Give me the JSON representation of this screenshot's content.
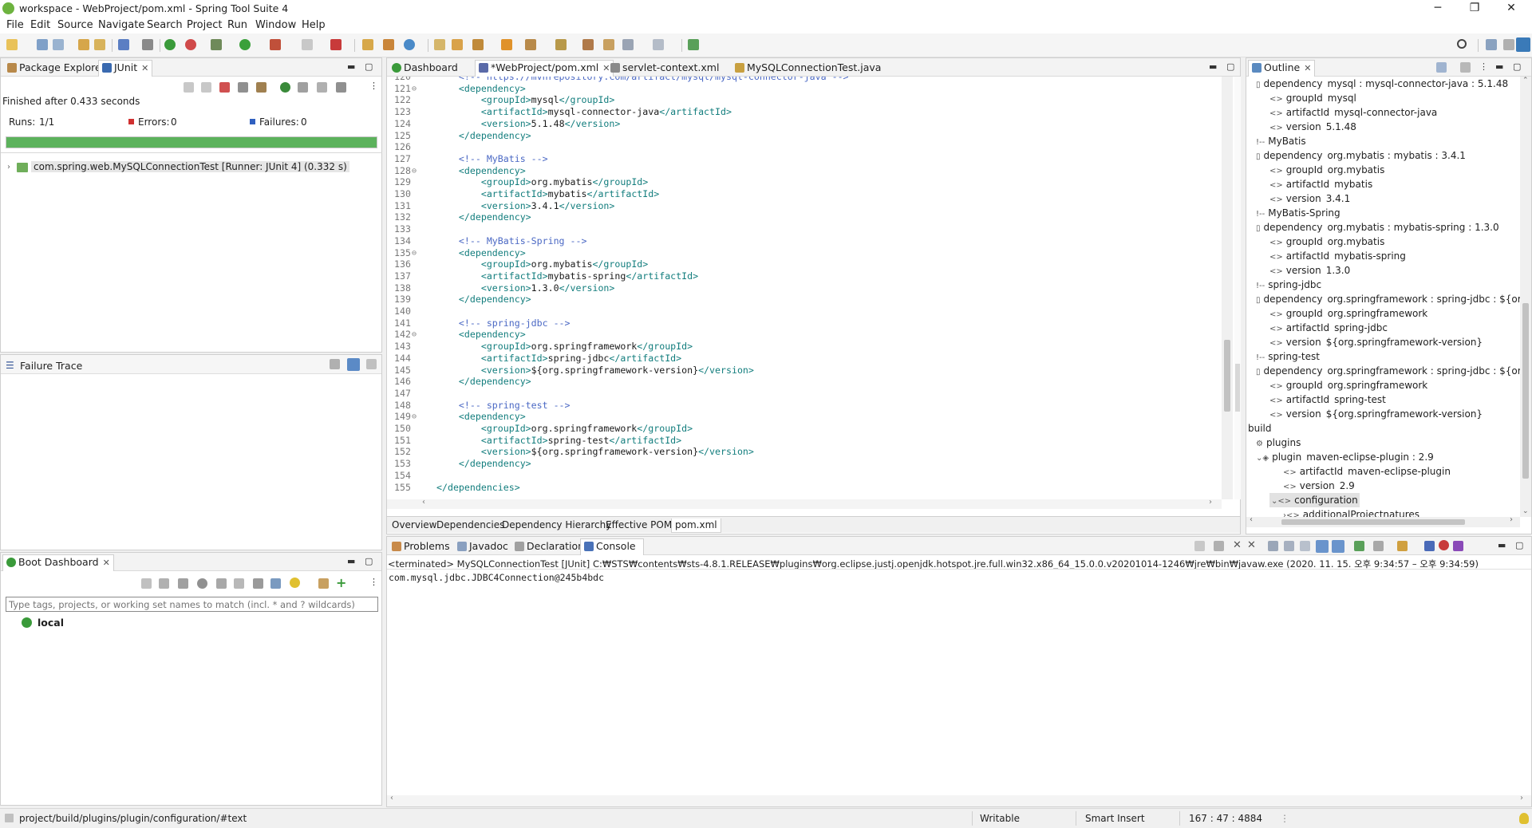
{
  "window": {
    "title": "workspace - WebProject/pom.xml - Spring Tool Suite 4",
    "minimize": "─",
    "maximize": "❐",
    "close": "✕"
  },
  "menu": [
    "File",
    "Edit",
    "Source",
    "Navigate",
    "Search",
    "Project",
    "Run",
    "Window",
    "Help"
  ],
  "left_top": {
    "tabs": [
      {
        "label": "Package Explorer"
      },
      {
        "label": "JUnit",
        "close": "✕"
      }
    ],
    "finished": "Finished after 0.433 seconds",
    "runs_label": "Runs:",
    "runs_value": "1/1",
    "errors_label": "Errors:",
    "errors_value": "0",
    "failures_label": "Failures:",
    "failures_value": "0",
    "progress_fraction": 1.0,
    "progress_color": "#5cb25c",
    "test_item": "com.spring.web.MySQLConnectionTest [Runner: JUnit 4] (0.332 s)",
    "failure_trace": "Failure Trace"
  },
  "boot_dashboard": {
    "tab": "Boot Dashboard",
    "close": "✕",
    "filter_placeholder": "Type tags, projects, or working set names to match (incl. * and ? wildcards)",
    "item": "local"
  },
  "editor": {
    "tabs": [
      {
        "label": "Dashboard"
      },
      {
        "label": "*WebProject/pom.xml",
        "close": "✕"
      },
      {
        "label": "servlet-context.xml"
      },
      {
        "label": "MySQLConnectionTest.java"
      }
    ],
    "lines": [
      {
        "n": "120",
        "fold": "",
        "indent": "    ",
        "parts": [
          [
            "com",
            "<!-- https://mvnrepository.com/artifact/mysql/mysql-connector-java -->"
          ]
        ]
      },
      {
        "n": "121",
        "fold": "⊖",
        "indent": "    ",
        "parts": [
          [
            "tag",
            "<dependency>"
          ]
        ]
      },
      {
        "n": "122",
        "fold": "",
        "indent": "        ",
        "parts": [
          [
            "tag",
            "<groupId>"
          ],
          [
            "txt",
            "mysql"
          ],
          [
            "tag",
            "</groupId>"
          ]
        ]
      },
      {
        "n": "123",
        "fold": "",
        "indent": "        ",
        "parts": [
          [
            "tag",
            "<artifactId>"
          ],
          [
            "txt",
            "mysql-connector-java"
          ],
          [
            "tag",
            "</artifactId>"
          ]
        ]
      },
      {
        "n": "124",
        "fold": "",
        "indent": "        ",
        "parts": [
          [
            "tag",
            "<version>"
          ],
          [
            "txt",
            "5.1.48"
          ],
          [
            "tag",
            "</version>"
          ]
        ]
      },
      {
        "n": "125",
        "fold": "",
        "indent": "    ",
        "parts": [
          [
            "tag",
            "</dependency>"
          ]
        ]
      },
      {
        "n": "126",
        "fold": "",
        "indent": "",
        "parts": []
      },
      {
        "n": "127",
        "fold": "",
        "indent": "    ",
        "parts": [
          [
            "com",
            "<!-- MyBatis -->"
          ]
        ]
      },
      {
        "n": "128",
        "fold": "⊖",
        "indent": "    ",
        "parts": [
          [
            "tag",
            "<dependency>"
          ]
        ]
      },
      {
        "n": "129",
        "fold": "",
        "indent": "        ",
        "parts": [
          [
            "tag",
            "<groupId>"
          ],
          [
            "txt",
            "org.mybatis"
          ],
          [
            "tag",
            "</groupId>"
          ]
        ]
      },
      {
        "n": "130",
        "fold": "",
        "indent": "        ",
        "parts": [
          [
            "tag",
            "<artifactId>"
          ],
          [
            "txt",
            "mybatis"
          ],
          [
            "tag",
            "</artifactId>"
          ]
        ]
      },
      {
        "n": "131",
        "fold": "",
        "indent": "        ",
        "parts": [
          [
            "tag",
            "<version>"
          ],
          [
            "txt",
            "3.4.1"
          ],
          [
            "tag",
            "</version>"
          ]
        ]
      },
      {
        "n": "132",
        "fold": "",
        "indent": "    ",
        "parts": [
          [
            "tag",
            "</dependency>"
          ]
        ]
      },
      {
        "n": "133",
        "fold": "",
        "indent": "",
        "parts": []
      },
      {
        "n": "134",
        "fold": "",
        "indent": "    ",
        "parts": [
          [
            "com",
            "<!-- MyBatis-Spring -->"
          ]
        ]
      },
      {
        "n": "135",
        "fold": "⊖",
        "indent": "    ",
        "parts": [
          [
            "tag",
            "<dependency>"
          ]
        ]
      },
      {
        "n": "136",
        "fold": "",
        "indent": "        ",
        "parts": [
          [
            "tag",
            "<groupId>"
          ],
          [
            "txt",
            "org.mybatis"
          ],
          [
            "tag",
            "</groupId>"
          ]
        ]
      },
      {
        "n": "137",
        "fold": "",
        "indent": "        ",
        "parts": [
          [
            "tag",
            "<artifactId>"
          ],
          [
            "txt",
            "mybatis-spring"
          ],
          [
            "tag",
            "</artifactId>"
          ]
        ]
      },
      {
        "n": "138",
        "fold": "",
        "indent": "        ",
        "parts": [
          [
            "tag",
            "<version>"
          ],
          [
            "txt",
            "1.3.0"
          ],
          [
            "tag",
            "</version>"
          ]
        ]
      },
      {
        "n": "139",
        "fold": "",
        "indent": "    ",
        "parts": [
          [
            "tag",
            "</dependency>"
          ]
        ]
      },
      {
        "n": "140",
        "fold": "",
        "indent": "",
        "parts": []
      },
      {
        "n": "141",
        "fold": "",
        "indent": "    ",
        "parts": [
          [
            "com",
            "<!-- spring-jdbc -->"
          ]
        ]
      },
      {
        "n": "142",
        "fold": "⊖",
        "indent": "    ",
        "parts": [
          [
            "tag",
            "<dependency>"
          ]
        ]
      },
      {
        "n": "143",
        "fold": "",
        "indent": "        ",
        "parts": [
          [
            "tag",
            "<groupId>"
          ],
          [
            "txt",
            "org.springframework"
          ],
          [
            "tag",
            "</groupId>"
          ]
        ]
      },
      {
        "n": "144",
        "fold": "",
        "indent": "        ",
        "parts": [
          [
            "tag",
            "<artifactId>"
          ],
          [
            "txt",
            "spring-jdbc"
          ],
          [
            "tag",
            "</artifactId>"
          ]
        ]
      },
      {
        "n": "145",
        "fold": "",
        "indent": "        ",
        "parts": [
          [
            "tag",
            "<version>"
          ],
          [
            "txt",
            "${org.springframework-version}"
          ],
          [
            "tag",
            "</version>"
          ]
        ]
      },
      {
        "n": "146",
        "fold": "",
        "indent": "    ",
        "parts": [
          [
            "tag",
            "</dependency>"
          ]
        ]
      },
      {
        "n": "147",
        "fold": "",
        "indent": "",
        "parts": []
      },
      {
        "n": "148",
        "fold": "",
        "indent": "    ",
        "parts": [
          [
            "com",
            "<!-- spring-test -->"
          ]
        ]
      },
      {
        "n": "149",
        "fold": "⊖",
        "indent": "    ",
        "parts": [
          [
            "tag",
            "<dependency>"
          ]
        ]
      },
      {
        "n": "150",
        "fold": "",
        "indent": "        ",
        "parts": [
          [
            "tag",
            "<groupId>"
          ],
          [
            "txt",
            "org.springframework"
          ],
          [
            "tag",
            "</groupId>"
          ]
        ]
      },
      {
        "n": "151",
        "fold": "",
        "indent": "        ",
        "parts": [
          [
            "tag",
            "<artifactId>"
          ],
          [
            "txt",
            "spring-test"
          ],
          [
            "tag",
            "</artifactId>"
          ]
        ]
      },
      {
        "n": "152",
        "fold": "",
        "indent": "        ",
        "parts": [
          [
            "tag",
            "<version>"
          ],
          [
            "txt",
            "${org.springframework-version}"
          ],
          [
            "tag",
            "</version>"
          ]
        ]
      },
      {
        "n": "153",
        "fold": "",
        "indent": "    ",
        "parts": [
          [
            "tag",
            "</dependency>"
          ]
        ]
      },
      {
        "n": "154",
        "fold": "",
        "indent": "",
        "parts": []
      },
      {
        "n": "155",
        "fold": "",
        "indent": "",
        "parts": [
          [
            "tag",
            "</dependencies>"
          ]
        ]
      }
    ],
    "bottom_tabs": [
      "Overview",
      "Dependencies",
      "Dependency Hierarchy",
      "Effective POM",
      "pom.xml"
    ]
  },
  "outline": {
    "tab": "Outline",
    "close": "✕",
    "items": [
      {
        "level": 0,
        "icon": "▯",
        "key": "dependency",
        "value": "mysql : mysql-connector-java : 5.1.48"
      },
      {
        "level": 1,
        "icon": "<>",
        "key": "groupId",
        "value": "mysql"
      },
      {
        "level": 1,
        "icon": "<>",
        "key": "artifactId",
        "value": "mysql-connector-java"
      },
      {
        "level": 1,
        "icon": "<>",
        "key": "version",
        "value": "5.1.48"
      },
      {
        "level": 0,
        "icon": "!--",
        "key": "MyBatis",
        "value": ""
      },
      {
        "level": 0,
        "icon": "▯",
        "key": "dependency",
        "value": "org.mybatis : mybatis : 3.4.1"
      },
      {
        "level": 1,
        "icon": "<>",
        "key": "groupId",
        "value": "org.mybatis"
      },
      {
        "level": 1,
        "icon": "<>",
        "key": "artifactId",
        "value": "mybatis"
      },
      {
        "level": 1,
        "icon": "<>",
        "key": "version",
        "value": "3.4.1"
      },
      {
        "level": 0,
        "icon": "!--",
        "key": "MyBatis-Spring",
        "value": ""
      },
      {
        "level": 0,
        "icon": "▯",
        "key": "dependency",
        "value": "org.mybatis : mybatis-spring : 1.3.0"
      },
      {
        "level": 1,
        "icon": "<>",
        "key": "groupId",
        "value": "org.mybatis"
      },
      {
        "level": 1,
        "icon": "<>",
        "key": "artifactId",
        "value": "mybatis-spring"
      },
      {
        "level": 1,
        "icon": "<>",
        "key": "version",
        "value": "1.3.0"
      },
      {
        "level": 0,
        "icon": "!--",
        "key": "spring-jdbc",
        "value": ""
      },
      {
        "level": 0,
        "icon": "▯",
        "key": "dependency",
        "value": "org.springframework : spring-jdbc : ${org.sprin"
      },
      {
        "level": 1,
        "icon": "<>",
        "key": "groupId",
        "value": "org.springframework"
      },
      {
        "level": 1,
        "icon": "<>",
        "key": "artifactId",
        "value": "spring-jdbc"
      },
      {
        "level": 1,
        "icon": "<>",
        "key": "version",
        "value": "${org.springframework-version}"
      },
      {
        "level": 0,
        "icon": "!--",
        "key": "spring-test",
        "value": ""
      },
      {
        "level": 0,
        "icon": "▯",
        "key": "dependency",
        "value": "org.springframework : spring-jdbc : ${org.sprin"
      },
      {
        "level": 1,
        "icon": "<>",
        "key": "groupId",
        "value": "org.springframework"
      },
      {
        "level": 1,
        "icon": "<>",
        "key": "artifactId",
        "value": "spring-test"
      },
      {
        "level": 1,
        "icon": "<>",
        "key": "version",
        "value": "${org.springframework-version}"
      },
      {
        "level": -1,
        "icon": "",
        "key": "build",
        "value": ""
      },
      {
        "level": 0,
        "icon": "⚙",
        "key": "plugins",
        "value": ""
      },
      {
        "level": 0,
        "icon": "⌄◈",
        "key": "plugin",
        "value": "maven-eclipse-plugin : 2.9"
      },
      {
        "level": 2,
        "icon": "<>",
        "key": "artifactId",
        "value": "maven-eclipse-plugin"
      },
      {
        "level": 2,
        "icon": "<>",
        "key": "version",
        "value": "2.9"
      },
      {
        "level": 1,
        "icon": "⌄<>",
        "key": "configuration",
        "value": "",
        "selected": true
      },
      {
        "level": 2,
        "icon": "›<>",
        "key": "additionalProjectnatures",
        "value": ""
      }
    ]
  },
  "console": {
    "tabs": [
      {
        "label": "Problems"
      },
      {
        "label": "Javadoc"
      },
      {
        "label": "Declaration"
      },
      {
        "label": "Console",
        "close": "✕"
      }
    ],
    "terminated": "<terminated> MySQLConnectionTest [JUnit] C:₩STS₩contents₩sts-4.8.1.RELEASE₩plugins₩org.eclipse.justj.openjdk.hotspot.jre.full.win32.x86_64_15.0.0.v20201014-1246₩jre₩bin₩javaw.exe  (2020. 11. 15. 오후 9:34:57 – 오후 9:34:59)",
    "output": "com.mysql.jdbc.JDBC4Connection@245b4bdc"
  },
  "status": {
    "path": "project/build/plugins/plugin/configuration/#text",
    "writable": "Writable",
    "insert_mode": "Smart Insert",
    "position": "167 : 47 : 4884"
  }
}
